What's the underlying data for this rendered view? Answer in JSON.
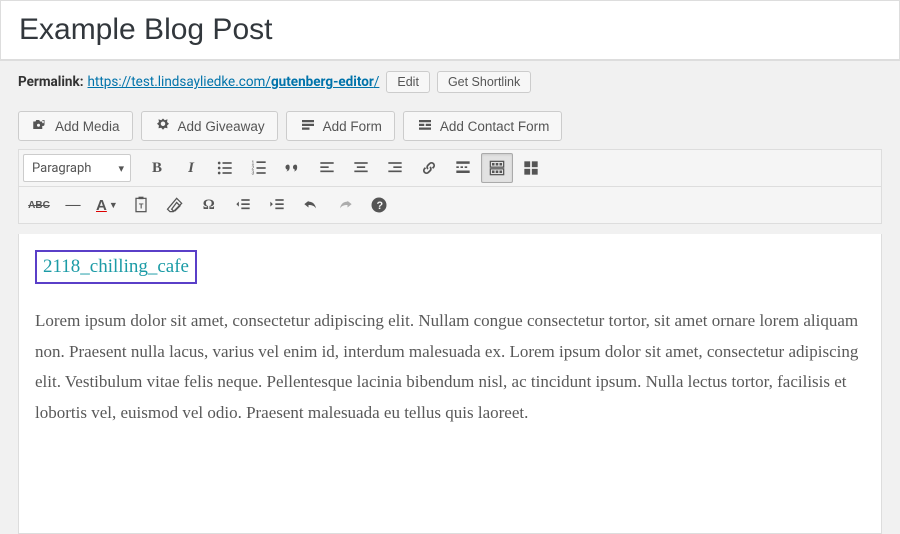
{
  "title": "Example Blog Post",
  "permalink": {
    "label": "Permalink:",
    "base": "https://test.lindsayliedke.com/",
    "slug": "gutenberg-editor",
    "trail": "/",
    "edit_label": "Edit",
    "shortlink_label": "Get Shortlink"
  },
  "media": {
    "add_media": "Add Media",
    "add_giveaway": "Add Giveaway",
    "add_form": "Add Form",
    "add_contact": "Add Contact Form"
  },
  "toolbar": {
    "format": "Paragraph",
    "bold": "B",
    "italic": "I",
    "strikethrough": "ABC",
    "hr": "—",
    "textcolor": "A",
    "omega": "Ω"
  },
  "content": {
    "link_text": "2118_chilling_cafe",
    "paragraph": "Lorem ipsum dolor sit amet, consectetur adipiscing elit. Nullam congue consectetur tortor, sit amet ornare lorem aliquam non. Praesent nulla lacus, varius vel enim id, interdum malesuada ex. Lorem ipsum dolor sit amet, consectetur adipiscing elit. Vestibulum vitae felis neque. Pellentesque lacinia bibendum nisl, ac tincidunt ipsum. Nulla lectus tortor, facilisis et lobortis vel, euismod vel odio. Praesent malesuada eu tellus quis laoreet."
  }
}
